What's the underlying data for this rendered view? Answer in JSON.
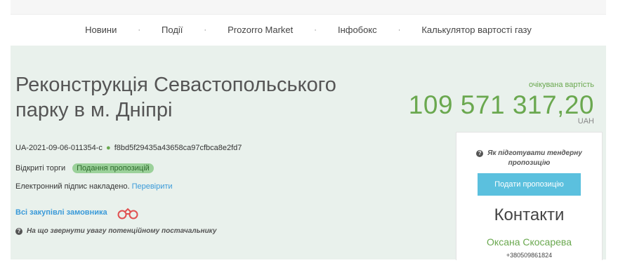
{
  "nav": {
    "items": [
      "Новини",
      "Події",
      "Prozorro Market",
      "Інфобокс",
      "Калькулятор вартості газу"
    ],
    "separator": "·"
  },
  "tender": {
    "title": "Реконструкція Севастопольського парку в м. Дніпрі",
    "budget_label": "очікувана вартість",
    "budget_amount": "109 571 317,20",
    "budget_currency": "UAH",
    "tender_id": "UA-2021-09-06-011354-c",
    "id_separator": "●",
    "hash": "f8bd5f29435a43658ca97cfbca8e2fd7",
    "procedure": "Відкриті торги",
    "status_badge": "Подання пропозицій",
    "signature_text": "Електронний підпис накладено.",
    "signature_link": "Перевірити",
    "all_purchases_link": "Всі закупівлі замовника",
    "hint": "На що звернути увагу потенційному постачальнику"
  },
  "sidebar": {
    "how_to": "Як підготувати тендерну пропозицію",
    "submit_button": "Подати пропозицію",
    "contacts_title": "Контакти",
    "contact_name": "Оксана Скосарева",
    "contact_phone": "+380509861824"
  },
  "colors": {
    "accent_green": "#6aa84f",
    "link_blue": "#3a9ad9",
    "button_blue": "#5bc0de",
    "panel_bg": "#e9f1ec"
  }
}
